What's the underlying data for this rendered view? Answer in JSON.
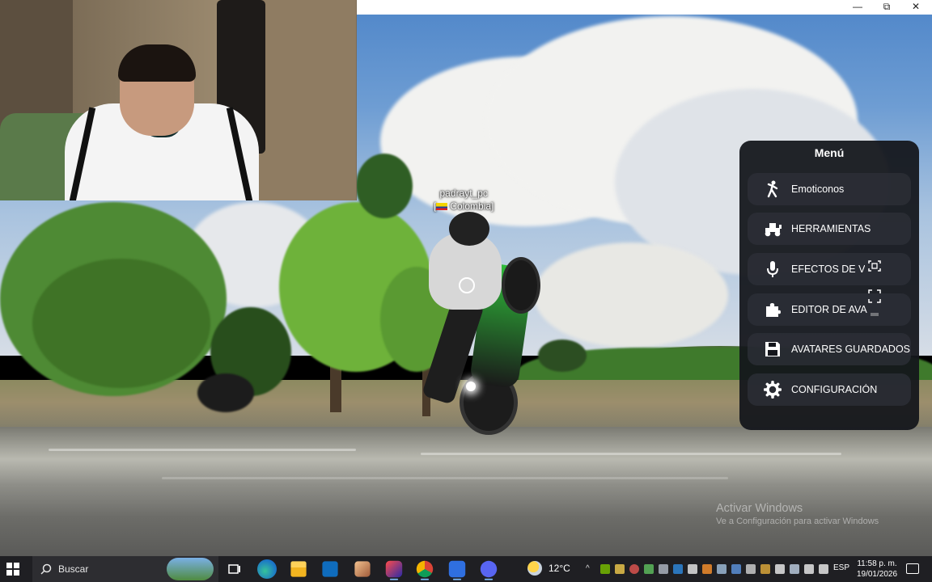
{
  "window": {
    "controls": {
      "minimize": "—",
      "maximize": "⧉",
      "close": "✕"
    }
  },
  "game": {
    "player": {
      "name": "padrayt_pc",
      "country": "Colombia"
    },
    "menu": {
      "title": "Menú",
      "items": [
        {
          "label": "Emoticonos",
          "icon": "person-dance-icon"
        },
        {
          "label": "HERRAMIENTAS",
          "icon": "tractor-icon"
        },
        {
          "label": "EFECTOS DE V",
          "icon": "microphone-icon"
        },
        {
          "label": "EDITOR DE AVA",
          "icon": "puzzle-icon"
        },
        {
          "label": "AVATARES GUARDADOS",
          "icon": "save-icon"
        },
        {
          "label": "CONFIGURACIÓN",
          "icon": "gear-icon"
        }
      ]
    }
  },
  "watermark": {
    "title": "Activar Windows",
    "subtitle": "Ve a Configuración para activar Windows"
  },
  "taskbar": {
    "search_label": "Buscar",
    "weather": "12°C",
    "language": "ESP",
    "time": "11:58 p. m.",
    "date": "19/01/2026",
    "apps": [
      "task-view",
      "edge",
      "file-explorer",
      "microsoft-store",
      "photo-app",
      "game-app",
      "chrome",
      "roblox",
      "discord"
    ]
  },
  "colors": {
    "menu_bg": "#14161c",
    "menu_item_bg": "#2d3038",
    "taskbar_bg": "#1f1f23"
  }
}
